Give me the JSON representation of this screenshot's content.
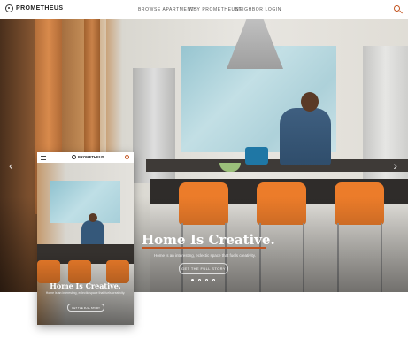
{
  "desktop": {
    "brand": "PROMETHEUS",
    "nav": [
      "BROWSE APARTMENTS",
      "WHY PROMETHEUS?",
      "NEIGHBOR LOGIN"
    ],
    "hero": {
      "headline": "Home Is Creative.",
      "subheadline": "Home is an interesting, eclectic space that fuels creativity.",
      "cta_label": "GET THE FULL STORY",
      "slides": 4,
      "active_slide": 1
    }
  },
  "mobile": {
    "brand": "PROMETHEUS",
    "hero": {
      "headline": "Home Is Creative.",
      "subheadline": "Home is an interesting, eclectic space that fuels creativity.",
      "cta_label": "GET THE FULL STORY"
    }
  },
  "colors": {
    "accent": "#c2531e",
    "stool": "#ec7c2a"
  },
  "icons": [
    "search-icon",
    "menu-icon",
    "arrow-left-icon",
    "arrow-right-icon",
    "logo-icon"
  ]
}
